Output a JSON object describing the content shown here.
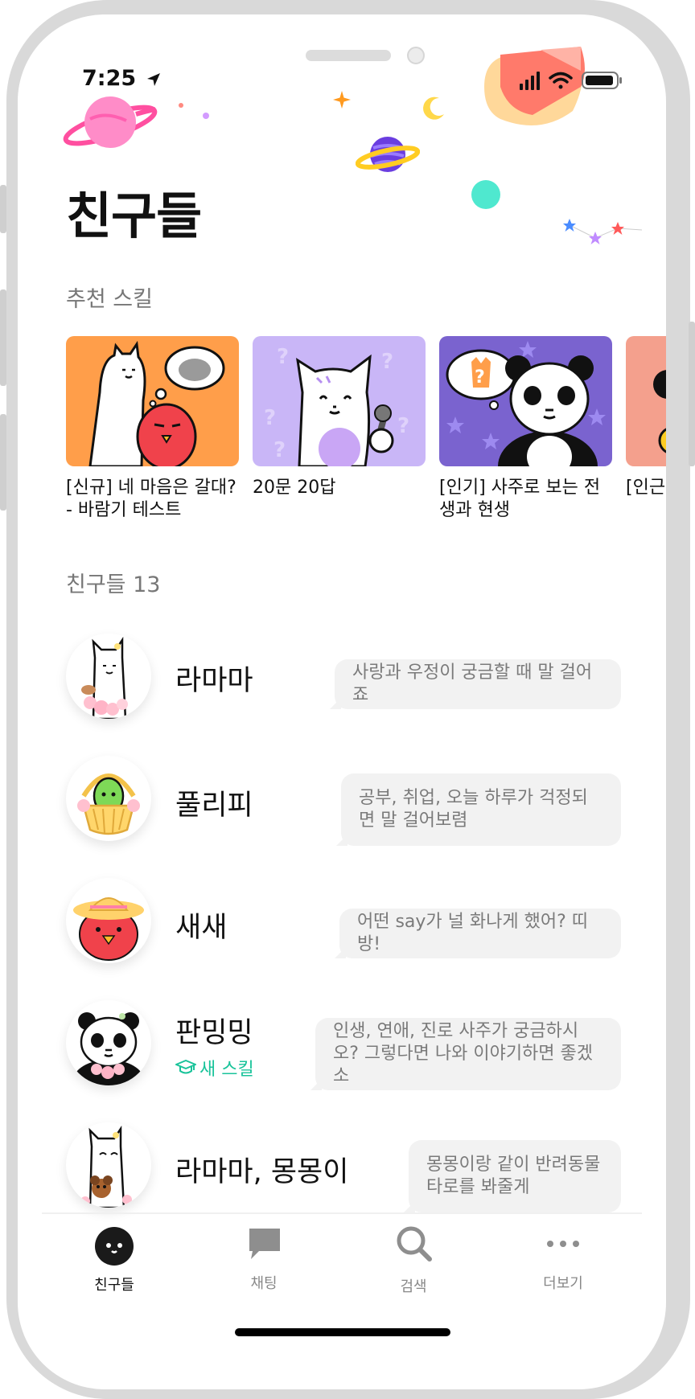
{
  "status_bar": {
    "time": "7:25"
  },
  "header": {
    "title": "친구들"
  },
  "skills": {
    "section_label": "추천 스킬",
    "cards": [
      {
        "title": "[신규] 네 마음은 갈대? - 바람기 테스트",
        "bg": "#ff9e4a"
      },
      {
        "title": "20문 20답",
        "bg": "#c9b6f7"
      },
      {
        "title": "[인기] 사주로 보는 전생과 현생",
        "bg": "#7a63cf"
      },
      {
        "title": "[인근",
        "bg": "#f4a08d"
      }
    ]
  },
  "friends": {
    "section_label": "친구들 13",
    "items": [
      {
        "name": "라마마",
        "message": "사랑과 우정이 궁금할 때 말 걸어죠"
      },
      {
        "name": "풀리피",
        "message": "공부, 취업, 오늘 하루가 걱정되면 말 걸어보렴"
      },
      {
        "name": "새새",
        "message": "어떤 say가 널 화나게 했어? 띠방!"
      },
      {
        "name": "판밍밍",
        "badge": "새 스킬",
        "message": "인생, 연애, 진로 사주가 궁금하시오? 그렇다면 나와 이야기하면 좋겠소"
      },
      {
        "name": "라마마, 몽몽이",
        "message": "몽몽이랑 같이 반려동물 타로를 봐줄게"
      }
    ]
  },
  "tabs": [
    {
      "label": "친구들",
      "icon": "friends-face-icon",
      "active": true
    },
    {
      "label": "채팅",
      "icon": "chat-bubble-icon",
      "active": false
    },
    {
      "label": "검색",
      "icon": "search-icon",
      "active": false
    },
    {
      "label": "더보기",
      "icon": "more-dots-icon",
      "active": false
    }
  ],
  "colors": {
    "accent": "#19c39a",
    "bubble": "#f2f2f2",
    "tab_inactive": "#888888"
  }
}
